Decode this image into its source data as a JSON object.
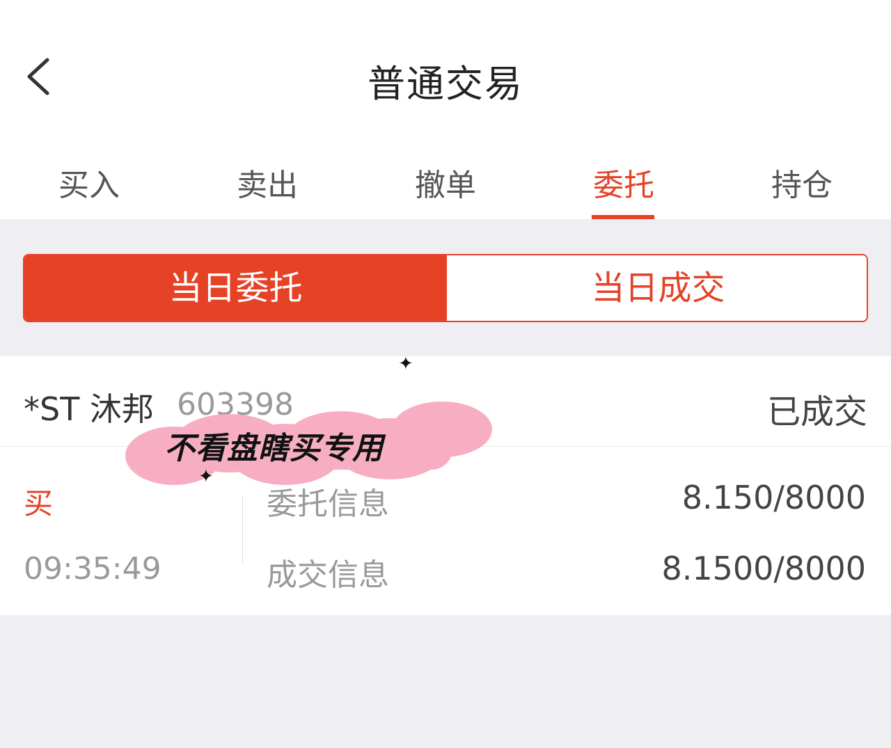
{
  "header": {
    "title": "普通交易"
  },
  "tabs": [
    {
      "label": "买入",
      "active": false
    },
    {
      "label": "卖出",
      "active": false
    },
    {
      "label": "撤单",
      "active": false
    },
    {
      "label": "委托",
      "active": true
    },
    {
      "label": "持仓",
      "active": false
    }
  ],
  "segment": {
    "left_label": "当日委托",
    "right_label": "当日成交",
    "selected": "left"
  },
  "order": {
    "stock_name": "*ST 沐邦",
    "stock_code": "603398",
    "status": "已成交",
    "side": "买",
    "time": "09:35:49",
    "order_info_label": "委托信息",
    "order_info_value": "8.150/8000",
    "deal_info_label": "成交信息",
    "deal_info_value": "8.1500/8000"
  },
  "overlay_sticker": {
    "text": "不看盘瞎买专用"
  },
  "colors": {
    "accent": "#e54226",
    "sticker_pink": "#f7aec3"
  }
}
